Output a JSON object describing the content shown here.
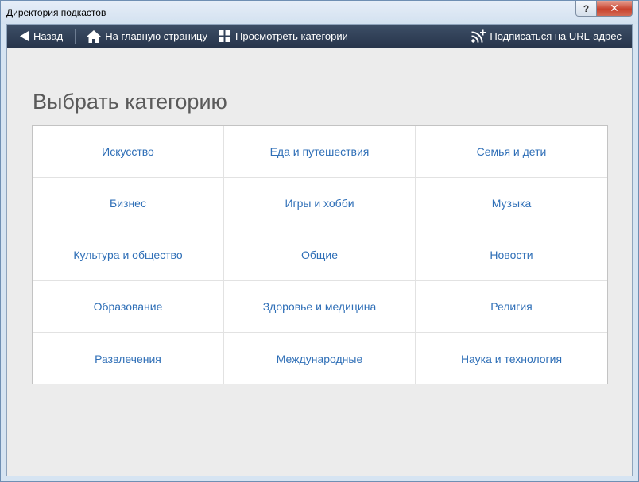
{
  "window": {
    "title": "Директория подкастов",
    "help_label": "?",
    "close_label": "✕"
  },
  "toolbar": {
    "back_label": "Назад",
    "home_label": "На главную страницу",
    "categories_label": "Просмотреть категории",
    "subscribe_label": "Подписаться на URL-адрес"
  },
  "main": {
    "heading": "Выбрать категорию",
    "categories": [
      "Искусство",
      "Еда и путешествия",
      "Семья и дети",
      "Бизнес",
      "Игры и хобби",
      "Музыка",
      "Культура и общество",
      "Общие",
      "Новости",
      "Образование",
      "Здоровье и медицина",
      "Религия",
      "Развлечения",
      "Международные",
      "Наука и технология"
    ]
  },
  "colors": {
    "toolbar_bg": "#2f3d54",
    "link": "#2f6fb7",
    "heading": "#5a5a5a"
  },
  "icons": [
    "back-arrow-icon",
    "home-icon",
    "grid-icon",
    "rss-add-icon"
  ]
}
